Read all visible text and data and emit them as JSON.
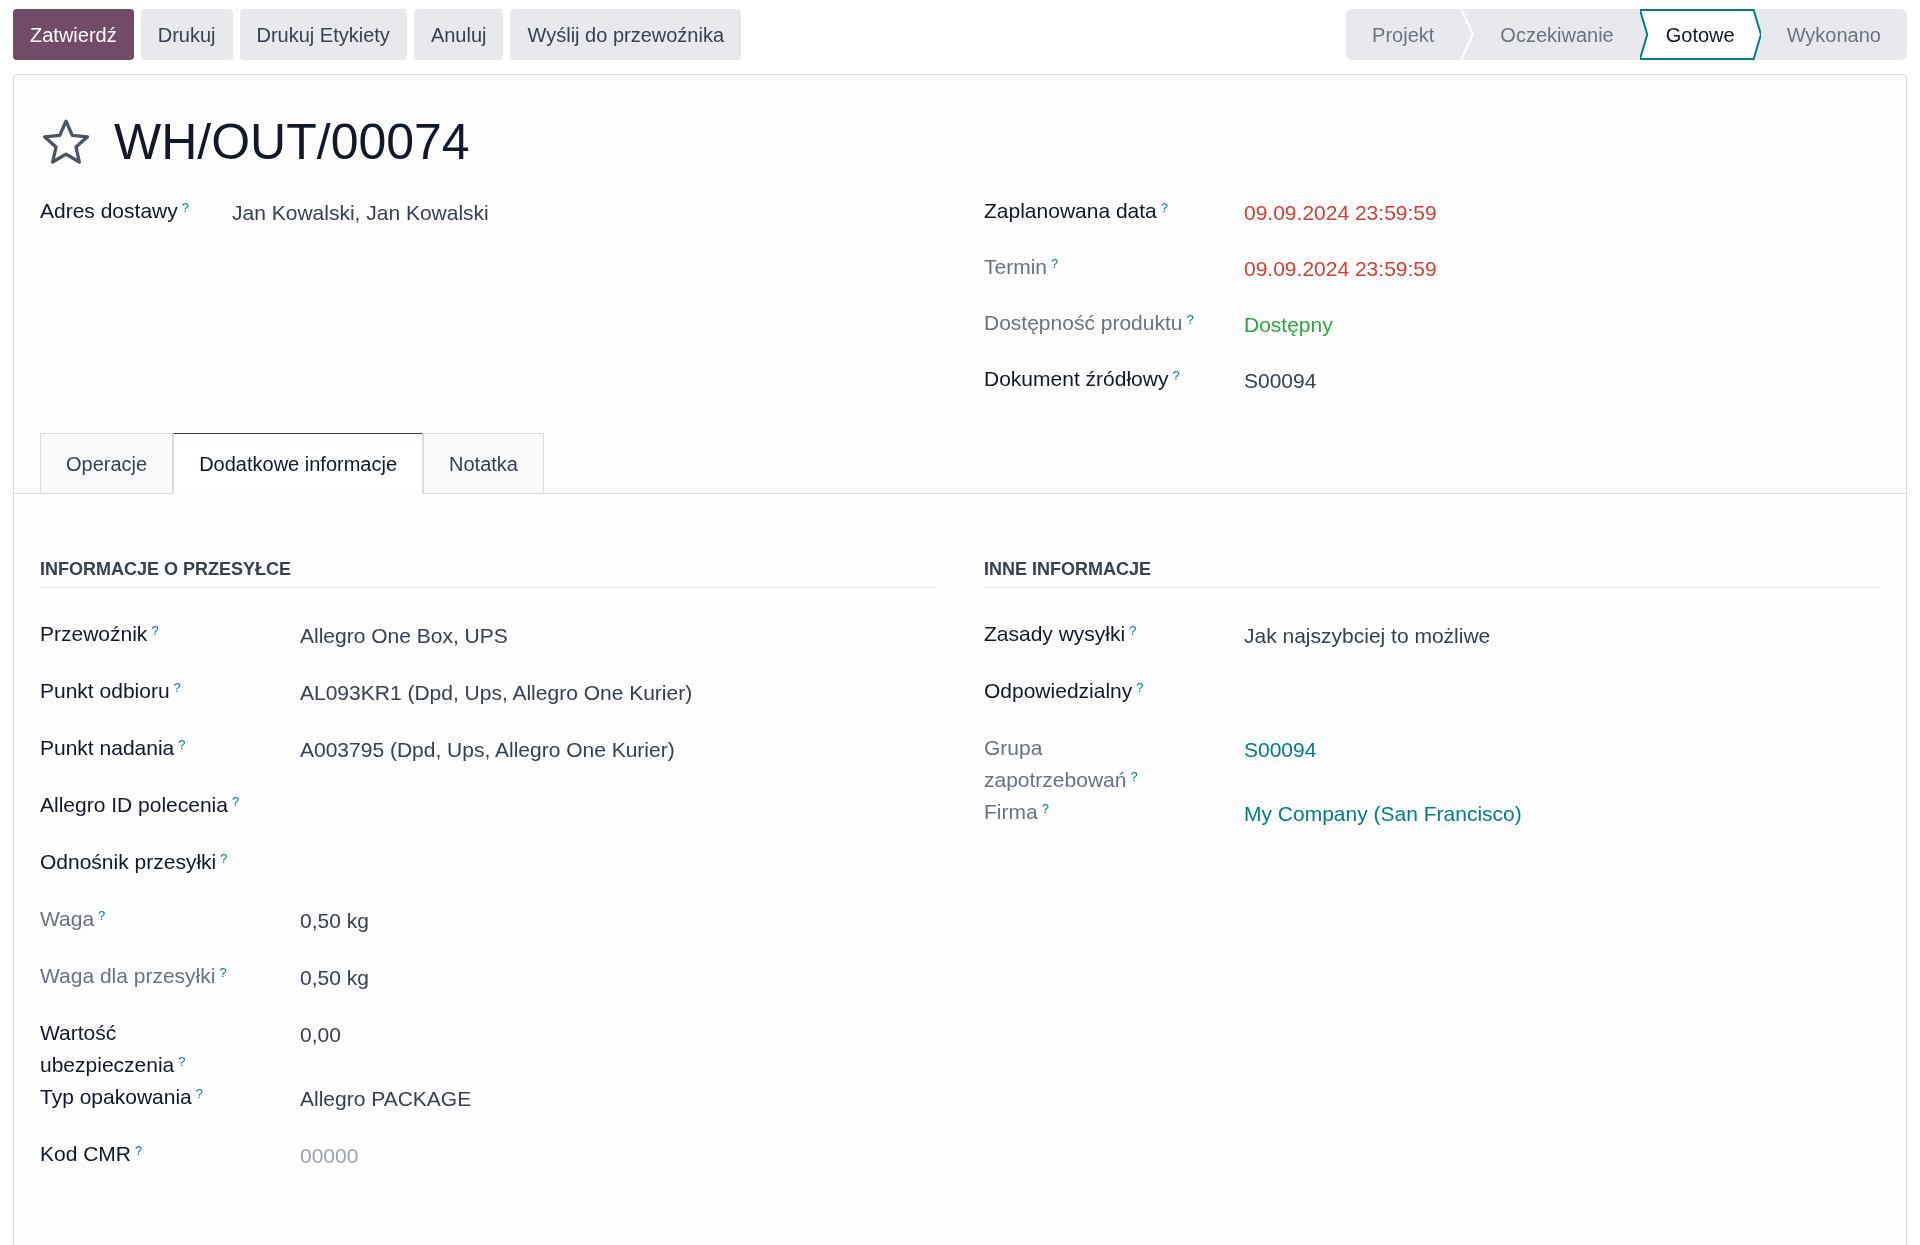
{
  "actions": [
    {
      "label": "Zatwierdź",
      "kind": "primary"
    },
    {
      "label": "Drukuj",
      "kind": "secondary"
    },
    {
      "label": "Drukuj Etykiety",
      "kind": "secondary"
    },
    {
      "label": "Anuluj",
      "kind": "secondary"
    },
    {
      "label": "Wyślij do przewoźnika",
      "kind": "secondary"
    }
  ],
  "stages": [
    {
      "label": "Projekt",
      "selected": false
    },
    {
      "label": "Oczekiwanie",
      "selected": false
    },
    {
      "label": "Gotowe",
      "selected": true
    },
    {
      "label": "Wykonano",
      "selected": false
    }
  ],
  "record": {
    "title": "WH/OUT/00074",
    "starred": false
  },
  "header_left": [
    {
      "label": "Adres dostawy",
      "kind": "strong",
      "help": "?",
      "value": "Jan Kowalski, Jan Kowalski",
      "color": "#374151"
    }
  ],
  "header_right": [
    {
      "label": "Zaplanowana data",
      "kind": "strong",
      "help": "?",
      "value": "09.09.2024 23:59:59",
      "color": "#d23f3a"
    },
    {
      "label": "Termin",
      "kind": "muted",
      "help": "?",
      "value": "09.09.2024 23:59:59",
      "color": "#d23f3a"
    },
    {
      "label": "Dostępność produktu",
      "kind": "muted",
      "help": "?",
      "value": "Dostępny",
      "color": "#28a745"
    },
    {
      "label": "Dokument źródłowy",
      "kind": "strong",
      "help": "?",
      "value": "S00094",
      "color": "#374151"
    }
  ],
  "tabs": [
    {
      "label": "Operacje",
      "selected": false
    },
    {
      "label": "Dodatkowe informacje",
      "selected": true
    },
    {
      "label": "Notatka",
      "selected": false
    }
  ],
  "sections": [
    {
      "title": "INFORMACJE O PRZESYŁCE",
      "fields": [
        {
          "label": "Przewoźnik",
          "kind": "strong",
          "help": "?",
          "value": "Allegro One Box, UPS",
          "color": "#374151"
        },
        {
          "label": "Punkt odbioru",
          "kind": "strong",
          "help": "?",
          "value": "AL093KR1 (Dpd, Ups, Allegro One Kurier)",
          "color": "#374151"
        },
        {
          "label": "Punkt nadania",
          "kind": "strong",
          "help": "?",
          "value": "A003795 (Dpd, Ups, Allegro One Kurier)",
          "color": "#374151"
        },
        {
          "label": "Allegro ID polecenia",
          "kind": "strong",
          "help": "?"
        },
        {
          "label": "Odnośnik przesyłki",
          "kind": "strong",
          "help": "?"
        },
        {
          "label": "Waga",
          "kind": "muted",
          "help": "?",
          "value": "0,50 kg",
          "color": "#374151"
        },
        {
          "label": "Waga dla przesyłki",
          "kind": "muted",
          "help": "?",
          "value": "0,50 kg",
          "color": "#374151"
        },
        {
          "label": "Wartość ubezpieczenia",
          "kind": "strong",
          "help": "?",
          "value": "0,00",
          "color": "#374151"
        },
        {
          "label": "Typ opakowania",
          "kind": "strong",
          "help": "?",
          "value": "Allegro PACKAGE",
          "color": "#374151"
        },
        {
          "label": "Kod CMR",
          "kind": "strong",
          "help": "?",
          "placeholder": "00000"
        }
      ]
    },
    {
      "title": "INNE INFORMACJE",
      "fields": [
        {
          "label": "Zasady wysyłki",
          "kind": "strong",
          "help": "?",
          "value": "Jak najszybciej to możliwe",
          "color": "#374151"
        },
        {
          "label": "Odpowiedzialny",
          "kind": "strong",
          "help": "?"
        },
        {
          "label": "Grupa zapotrzebowań",
          "kind": "muted",
          "help": "?",
          "value": "S00094",
          "color": "#017e84"
        },
        {
          "label": "Firma",
          "kind": "muted",
          "help": "?",
          "value": "My Company (San Francisco)",
          "color": "#017e84"
        }
      ]
    }
  ]
}
